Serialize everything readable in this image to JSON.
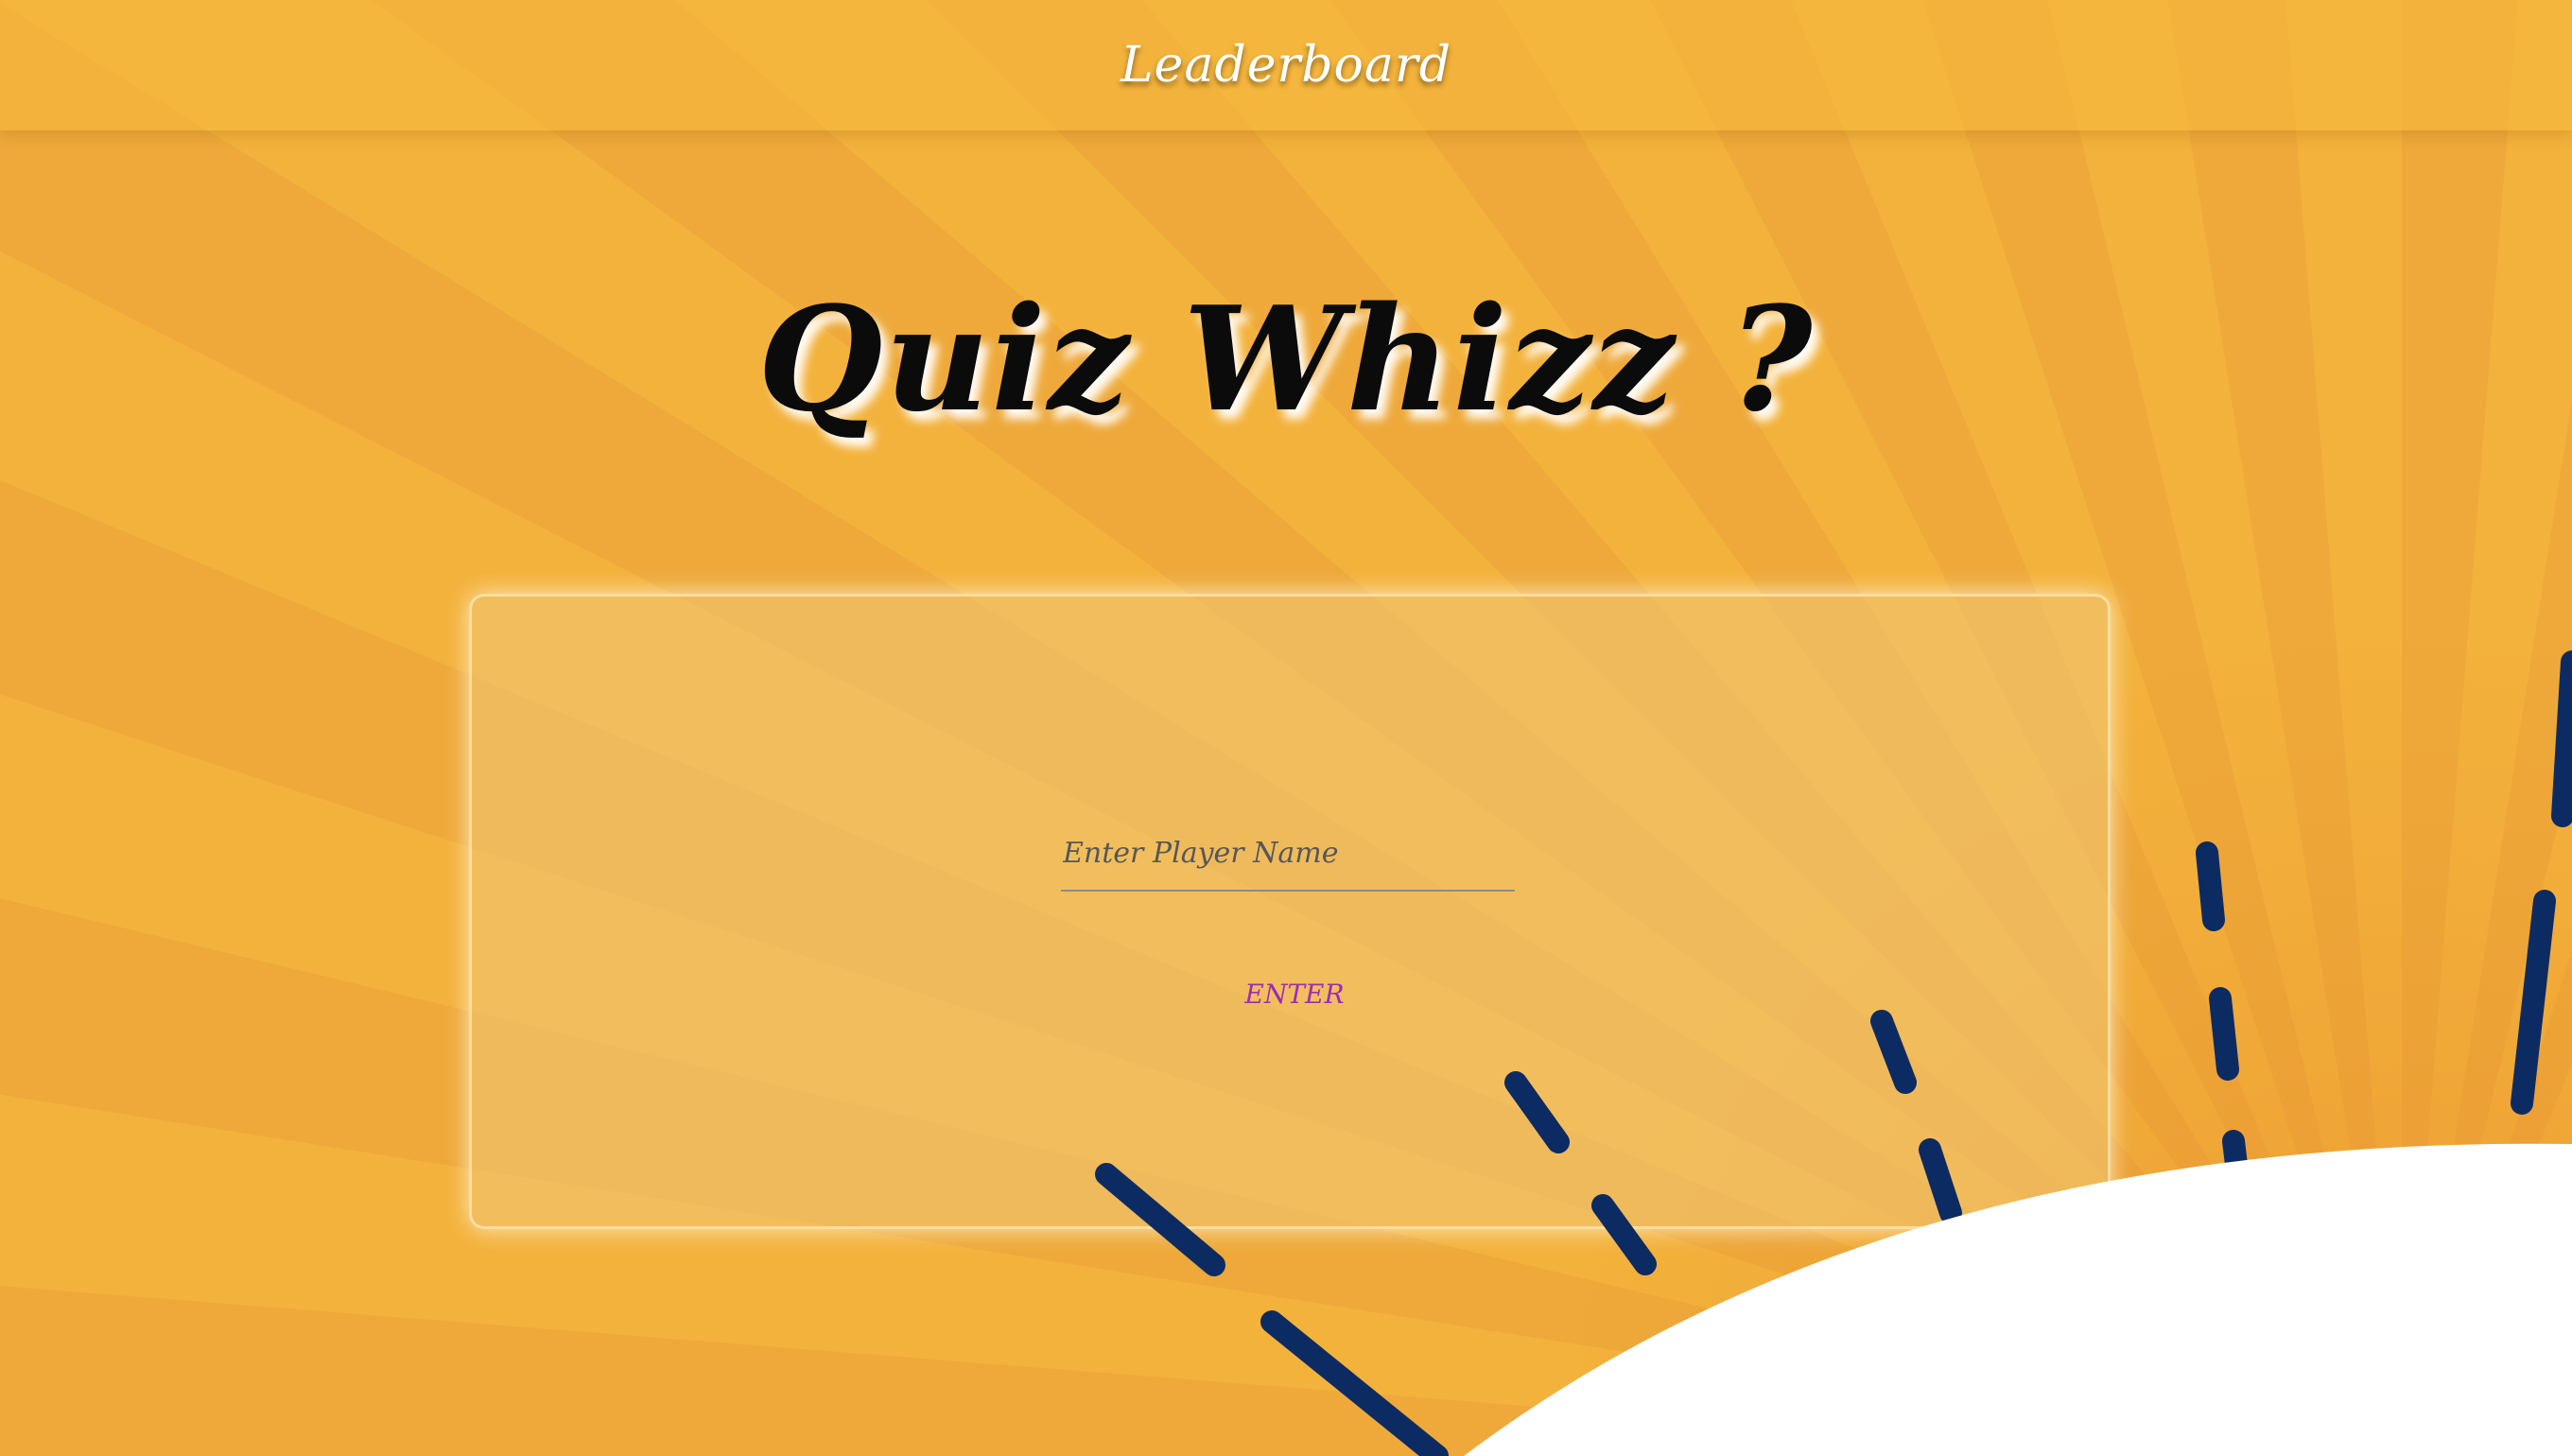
{
  "header": {
    "leaderboard_label": "Leaderboard"
  },
  "main": {
    "title": "Quiz Whizz ?"
  },
  "form": {
    "name_placeholder": "Enter Player Name",
    "name_value": "",
    "enter_label": "ENTER"
  },
  "colors": {
    "background": "#f3b23c",
    "title": "#0b0b0b",
    "enter_button": "#9b2fb3",
    "dash_lines": "#0d2b63"
  }
}
